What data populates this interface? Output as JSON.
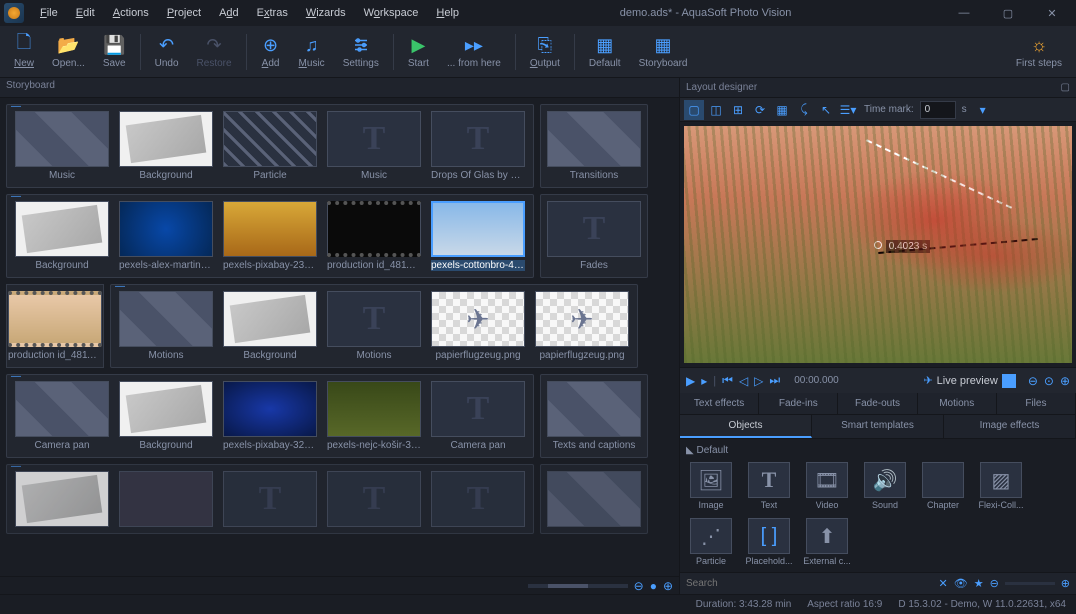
{
  "title": "demo.ads* - AquaSoft Photo Vision",
  "menu": [
    "File",
    "Edit",
    "Actions",
    "Project",
    "Add",
    "Extras",
    "Wizards",
    "Workspace",
    "Help"
  ],
  "toolbar": {
    "new": "New",
    "open": "Open...",
    "save": "Save",
    "undo": "Undo",
    "restore": "Restore",
    "add": "Add",
    "music": "Music",
    "settings": "Settings",
    "start": "Start",
    "fromhere": "... from here",
    "output": "Output",
    "default": "Default",
    "storyboard": "Storyboard",
    "firststeps": "First steps"
  },
  "panels": {
    "storyboard": "Storyboard",
    "layout": "Layout designer"
  },
  "storyboard": {
    "row1": {
      "group": [
        "Music",
        "Background",
        "Particle",
        "Music",
        "Drops Of Glas by Musi..."
      ],
      "single": "Transitions"
    },
    "row2": {
      "group": [
        "Background",
        "pexels-alex-martin-11...",
        "pexels-pixabay-23572...",
        "production id_481187...",
        "pexels-cottonbro-497..."
      ],
      "single": "Fades"
    },
    "row3": {
      "left": "production id_481186...",
      "group": [
        "Motions",
        "Background",
        "Motions",
        "papierflugzeug.png",
        "papierflugzeug.png"
      ]
    },
    "row4": {
      "group": [
        "Camera pan",
        "Background",
        "pexels-pixabay-32605...",
        "pexels-nejc-košir-338...",
        "Camera pan"
      ],
      "single": "Texts and captions"
    }
  },
  "layout": {
    "timemark_label": "Time mark:",
    "timemark_value": "0",
    "timemark_unit": "s",
    "preview_coord": "0.4023 s"
  },
  "playback": {
    "time": "00:00.000",
    "live": "Live preview"
  },
  "tabs1": [
    "Text effects",
    "Fade-ins",
    "Fade-outs",
    "Motions",
    "Files"
  ],
  "tabs2": [
    "Objects",
    "Smart templates",
    "Image effects"
  ],
  "objects": {
    "section": "Default",
    "items": [
      "Image",
      "Text",
      "Video",
      "Sound",
      "Chapter",
      "Flexi-Coll...",
      "Particle",
      "Placehold...",
      "External c..."
    ]
  },
  "search": {
    "placeholder": "Search"
  },
  "status": {
    "duration": "Duration: 3:43.28 min",
    "aspect": "Aspect ratio 16:9",
    "version": "D 15.3.02 - Demo, W 11.0.22631, x64"
  }
}
